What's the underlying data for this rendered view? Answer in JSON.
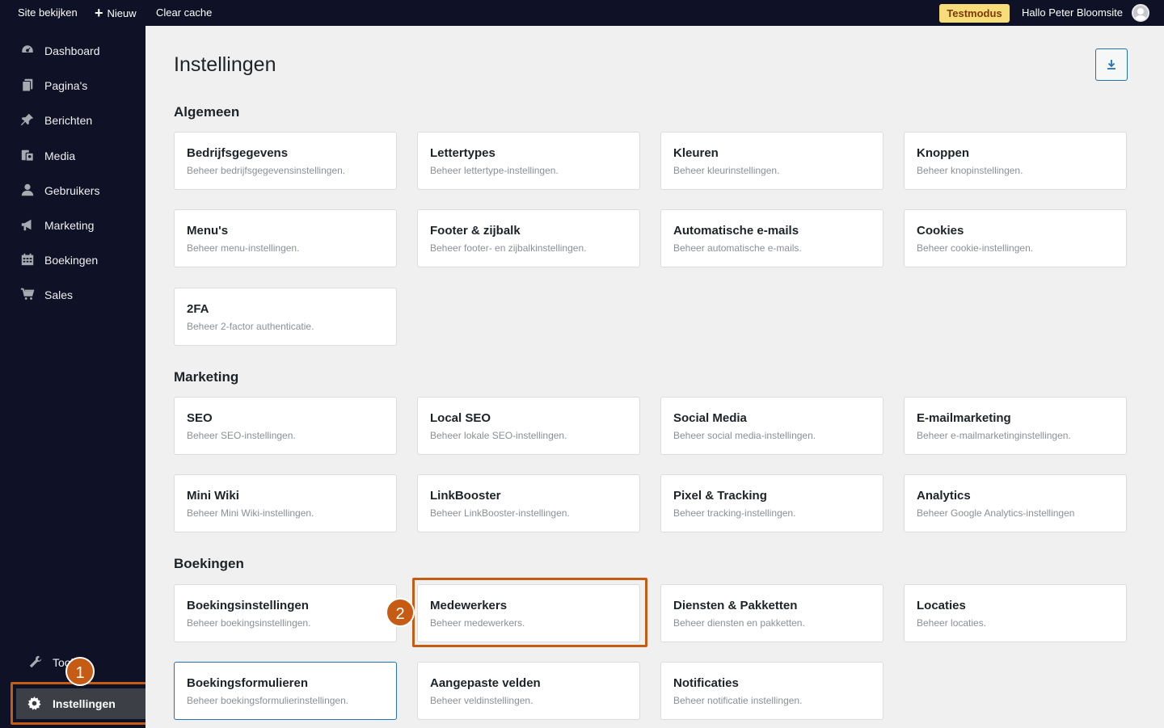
{
  "topbar": {
    "site_label": "Site bekijken",
    "new_label": "Nieuw",
    "cache_label": "Clear cache",
    "testmode_label": "Testmodus",
    "greeting": "Hallo Peter Bloomsite"
  },
  "sidebar": {
    "items": [
      {
        "label": "Dashboard",
        "icon": "dashboard-icon"
      },
      {
        "label": "Pagina's",
        "icon": "pages-icon"
      },
      {
        "label": "Berichten",
        "icon": "pin-icon"
      },
      {
        "label": "Media",
        "icon": "media-icon"
      },
      {
        "label": "Gebruikers",
        "icon": "user-icon"
      },
      {
        "label": "Marketing",
        "icon": "megaphone-icon"
      },
      {
        "label": "Boekingen",
        "icon": "calendar-icon"
      },
      {
        "label": "Sales",
        "icon": "cart-icon"
      }
    ],
    "tools_label": "Tools",
    "settings_label": "Instellingen"
  },
  "annotations": {
    "step1": "1",
    "step2": "2",
    "highlight_color": "#c65b13"
  },
  "main": {
    "title": "Instellingen",
    "sections": [
      {
        "title": "Algemeen",
        "cards": [
          {
            "title": "Bedrijfsgegevens",
            "desc": "Beheer bedrijfsgegevensinstellingen."
          },
          {
            "title": "Lettertypes",
            "desc": "Beheer lettertype-instellingen."
          },
          {
            "title": "Kleuren",
            "desc": "Beheer kleurinstellingen."
          },
          {
            "title": "Knoppen",
            "desc": "Beheer knopinstellingen."
          },
          {
            "title": "Menu's",
            "desc": "Beheer menu-instellingen."
          },
          {
            "title": "Footer & zijbalk",
            "desc": "Beheer footer- en zijbalkinstellingen."
          },
          {
            "title": "Automatische e-mails",
            "desc": "Beheer automatische e-mails."
          },
          {
            "title": "Cookies",
            "desc": "Beheer cookie-instellingen."
          },
          {
            "title": "2FA",
            "desc": "Beheer 2-factor authenticatie."
          }
        ]
      },
      {
        "title": "Marketing",
        "cards": [
          {
            "title": "SEO",
            "desc": "Beheer SEO-instellingen."
          },
          {
            "title": "Local SEO",
            "desc": "Beheer lokale SEO-instellingen."
          },
          {
            "title": "Social Media",
            "desc": "Beheer social media-instellingen."
          },
          {
            "title": "E-mailmarketing",
            "desc": "Beheer e-mailmarketinginstellingen."
          },
          {
            "title": "Mini Wiki",
            "desc": "Beheer Mini Wiki-instellingen."
          },
          {
            "title": "LinkBooster",
            "desc": "Beheer LinkBooster-instellingen."
          },
          {
            "title": "Pixel & Tracking",
            "desc": "Beheer tracking-instellingen."
          },
          {
            "title": "Analytics",
            "desc": "Beheer Google Analytics-instellingen"
          }
        ]
      },
      {
        "title": "Boekingen",
        "cards": [
          {
            "title": "Boekingsinstellingen",
            "desc": "Beheer boekingsinstellingen."
          },
          {
            "title": "Medewerkers",
            "desc": "Beheer medewerkers."
          },
          {
            "title": "Diensten & Pakketten",
            "desc": "Beheer diensten en pakketten."
          },
          {
            "title": "Locaties",
            "desc": "Beheer locaties."
          },
          {
            "title": "Boekingsformulieren",
            "desc": "Beheer boekingsformulierinstellingen."
          },
          {
            "title": "Aangepaste velden",
            "desc": "Beheer veldinstellingen."
          },
          {
            "title": "Notificaties",
            "desc": "Beheer notificatie instellingen."
          }
        ]
      }
    ]
  }
}
